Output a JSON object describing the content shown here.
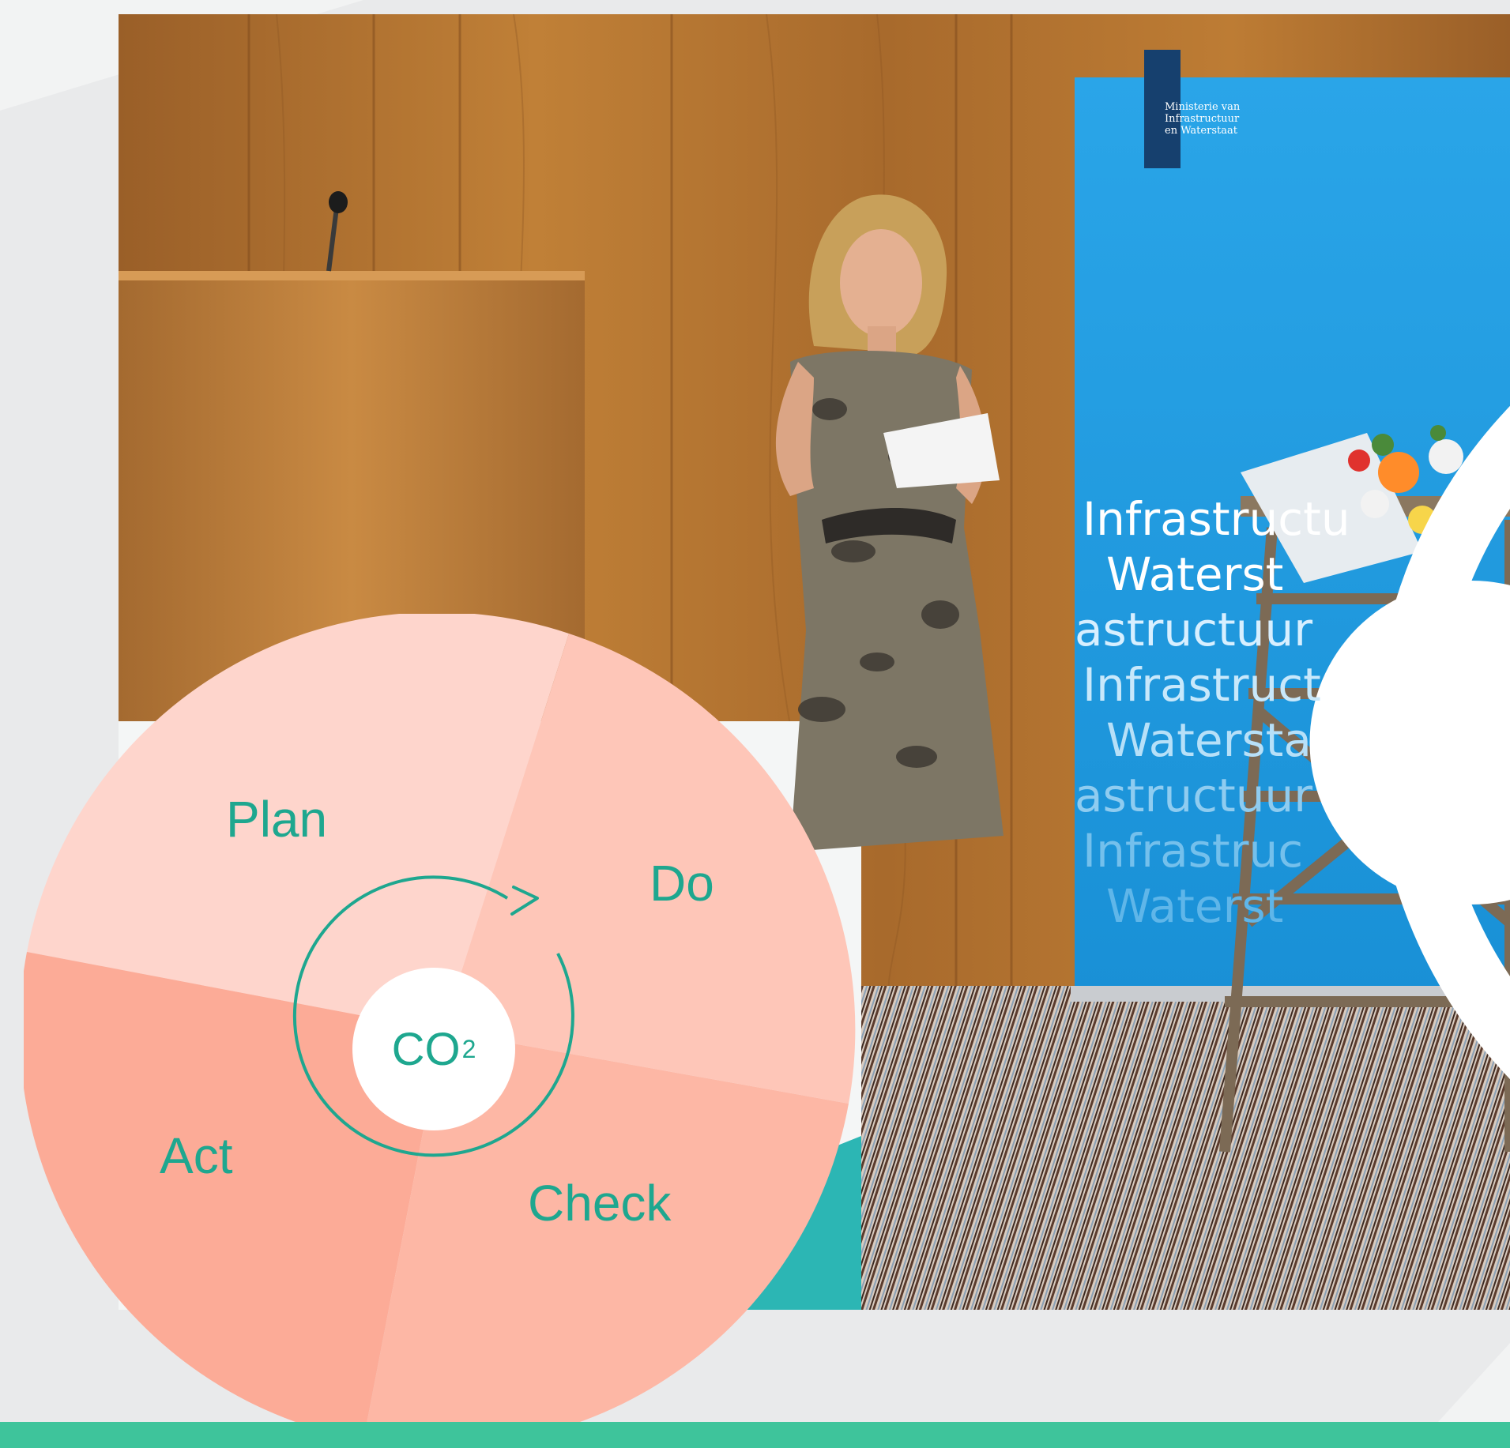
{
  "banner": {
    "org_line1": "Ministerie van Infrastructuur",
    "org_line2": "en Waterstaat",
    "repeat_lines": [
      "Infrastructu",
      "Waterst",
      "astructuur",
      "Infrastruct",
      "Watersta",
      "astructuur",
      "Infrastruc",
      "Waterst"
    ]
  },
  "pdca": {
    "plan": "Plan",
    "do": "Do",
    "check": "Check",
    "act": "Act",
    "center_main": "CO",
    "center_sub": "2"
  },
  "colors": {
    "accent": "#1ea78f",
    "banner_blue": "#1f9ee2",
    "bottom_bar": "#3ec49b",
    "wood": "#b57532"
  }
}
